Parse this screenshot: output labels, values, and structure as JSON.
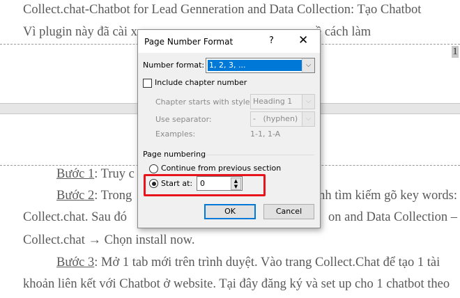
{
  "document": {
    "line1": "Collect.chat-Chatbot for Lead Genneration and Data Collection: Tạo Chatbot",
    "line2_left": "Vì plugin này đã cài x",
    "line2_right": "ề cách làm",
    "header_page_number": "1",
    "step1_label": "Bước 1",
    "step1_text": ": Truy c",
    "step2_label": "Bước 2",
    "step2_text": ": Trong",
    "step2_right": "nh tìm kiếm gõ key words:",
    "line_collect_left": "Collect.chat. Sau đó",
    "line_collect_right": "on and Data Collection –",
    "line_install": "Collect.chat → Chọn install now.",
    "step3_label": "Bước 3",
    "step3_text": ": Mở 1 tab mới trên trình duyệt. Vào trang Collect.Chat để tạo 1 tài",
    "step3_line2": "khoản liên kết với Chatbot ở website. Tại đây đăng ký và set up cho 1 chatbot theo"
  },
  "dialog": {
    "title": "Page Number Format",
    "help": "?",
    "close": "✕",
    "number_format_label": "Number format:",
    "number_format_value": "1, 2, 3, ...",
    "include_chapter_label": "Include chapter number",
    "include_chapter_checked": false,
    "chapter_style_label": "Chapter starts with style:",
    "chapter_style_value": "Heading 1",
    "separator_label": "Use separator:",
    "separator_value": "-   (hyphen)",
    "examples_label": "Examples:",
    "examples_value": "1-1, 1-A",
    "page_numbering_label": "Page numbering",
    "continue_label": "Continue from previous section",
    "start_at_label": "Start at:",
    "start_at_value": "0",
    "ok": "OK",
    "cancel": "Cancel",
    "highlight_color": "#e8141b"
  }
}
